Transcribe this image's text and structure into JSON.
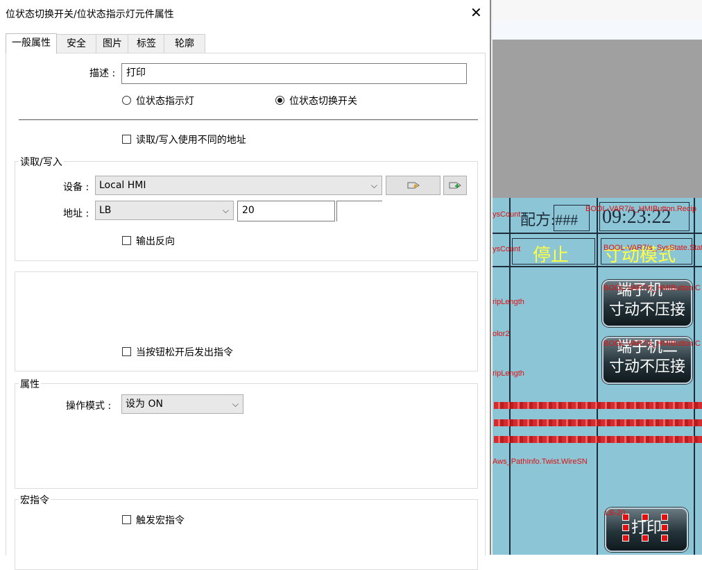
{
  "dialog": {
    "title": "位状态切换开关/位状态指示灯元件属性",
    "close_glyph": "✕",
    "tabs": [
      "一般属性",
      "安全",
      "图片",
      "标签",
      "轮廓"
    ],
    "active_tab": 0
  },
  "general": {
    "description_label": "描述 :",
    "description_value": "打印",
    "radio_indicator": "位状态指示灯",
    "radio_switch": "位状态切换开关",
    "selected_mode": "switch",
    "diff_addr_label": "读取/写入使用不同的地址",
    "diff_addr_checked": false
  },
  "readwrite": {
    "group_title": "读取/写入",
    "device_label": "设备 :",
    "device_value": "Local HMI",
    "address_label": "地址 :",
    "address_type": "LB",
    "address_value": "20",
    "invert_label": "输出反向",
    "invert_checked": false,
    "tag_button_icon": "tag-icon",
    "tag_add_button_icon": "tag-add-icon"
  },
  "release": {
    "label": "当按钮松开后发出指令",
    "checked": false
  },
  "attributes": {
    "group_title": "属性",
    "mode_label": "操作模式 :",
    "mode_value": "设为 ON"
  },
  "macro": {
    "group_title": "宏指令",
    "trigger_label": "触发宏指令",
    "checked": false
  },
  "background": {
    "recipe_label": "配方:###",
    "time_label": "09:23:22",
    "stop_label": "停止",
    "mode_label": "寸动模式",
    "btn1_line1": "端子机一",
    "btn1_line2": "寸动不压接",
    "btn2_line1": "端子机二",
    "btn2_line2": "寸动不压接",
    "print_button": "打印",
    "red_labels": [
      "ysCount",
      "BOOL-VAR7/s_HMIButton.Recip",
      "ysCount",
      "BOOL-VAR7/s_SysState.Stat",
      "BOOL-VAR7/s_HMIButton.C",
      "ripLength",
      "olor2",
      "BOOL-VAR7/s_HMIButton.C",
      "ripLength",
      "Aws_PathInfo.Twist.WireSN",
      "LB-20"
    ],
    "colors": {
      "panel": "#8cc5d6",
      "accent_red": "#e01010"
    }
  }
}
